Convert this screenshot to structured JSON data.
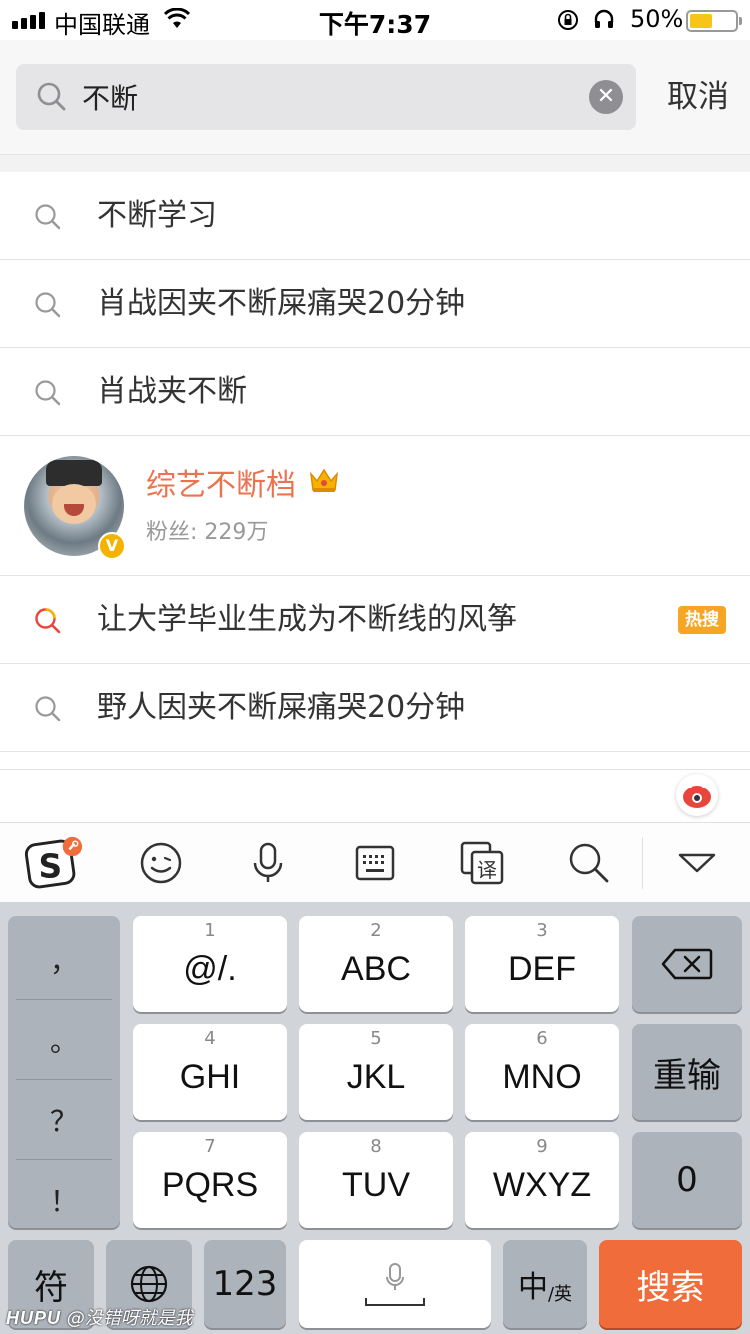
{
  "status_bar": {
    "carrier": "中国联通",
    "time": "下午7:37",
    "battery_percent": "50%",
    "battery_level": 0.5
  },
  "search": {
    "query": "不断",
    "cancel_label": "取消"
  },
  "suggestions": [
    {
      "type": "query",
      "text": "不断学习"
    },
    {
      "type": "query",
      "text": "肖战因夹不断屎痛哭20分钟"
    },
    {
      "type": "query",
      "text": "肖战夹不断"
    },
    {
      "type": "user",
      "name": "综艺不断档",
      "fans": "粉丝: 229万",
      "verified_badge": "V"
    },
    {
      "type": "hot",
      "text": "让大学毕业生成为不断线的风筝",
      "badge": "热搜"
    },
    {
      "type": "query",
      "text": "野人因夹不断屎痛哭20分钟"
    }
  ],
  "toolbar": {
    "icons": [
      "sogou-logo-icon",
      "emoji-icon",
      "microphone-icon",
      "keyboard-icon",
      "translate-icon",
      "search-icon",
      "collapse-keyboard-icon"
    ],
    "translate_char": "译"
  },
  "keyboard": {
    "punctuation": [
      "，",
      "。",
      "？",
      "！"
    ],
    "keys": [
      {
        "num": "1",
        "main": "@/."
      },
      {
        "num": "2",
        "main": "ABC"
      },
      {
        "num": "3",
        "main": "DEF"
      },
      {
        "num": "4",
        "main": "GHI"
      },
      {
        "num": "5",
        "main": "JKL"
      },
      {
        "num": "6",
        "main": "MNO"
      },
      {
        "num": "7",
        "main": "PQRS"
      },
      {
        "num": "8",
        "main": "TUV"
      },
      {
        "num": "9",
        "main": "WXYZ"
      }
    ],
    "reinput_label": "重输",
    "zero_label": "0",
    "symbol_label": "符",
    "num_label": "123",
    "lang_main": "中",
    "lang_sub": "/英",
    "search_label": "搜索"
  },
  "watermark": {
    "brand": "HUPU",
    "user": "@没错呀就是我"
  },
  "colors": {
    "accent_orange": "#eb7350",
    "search_key": "#f06c3a",
    "hot_badge": "#f6a623",
    "verified": "#f5b301"
  }
}
